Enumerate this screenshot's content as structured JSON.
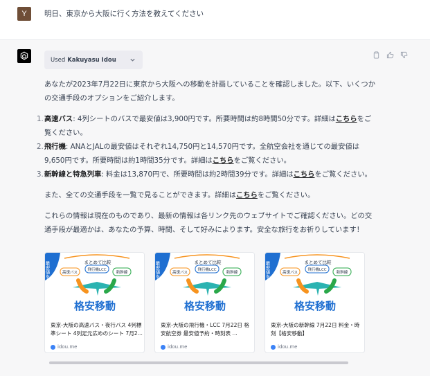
{
  "user": {
    "avatar_letter": "Y",
    "message": "明日、東京から大阪に行く方法を教えてください"
  },
  "assistant": {
    "avatar_icon": "openai-logo-icon",
    "plugin_pill": {
      "prefix": "Used",
      "name": "Kakuyasu Idou"
    },
    "actions": [
      "clipboard-icon",
      "thumbs-up-icon",
      "thumbs-down-icon"
    ],
    "intro": "あなたが2023年7月22日に東京から大阪への移動を計画していることを確認しました。以下、いくつかの交通手段のオプションをご紹介します。",
    "items": [
      {
        "num": "1.",
        "label": "高速バス",
        "text": ": 4列シートのバスで最安値は3,900円です。所要時間は約8時間50分です。詳細は",
        "link": "こちら",
        "tail": "をご覧ください。"
      },
      {
        "num": "2.",
        "label": "飛行機",
        "text": ": ANAとJALの最安値はそれぞれ14,750円と14,570円です。全航空会社を通じての最安値は9,650円です。所要時間は約1時間35分です。詳細は",
        "link": "こちら",
        "tail": "をご覧ください。"
      },
      {
        "num": "3.",
        "label": "新幹線と特急列車",
        "text": ": 料金は13,870円で、所要時間は約2時間39分です。詳細は",
        "link": "こちら",
        "tail": "をご覧ください。"
      }
    ],
    "summary_pre": "また、全ての交通手段を一覧で見ることができます。詳細は",
    "summary_link": "こちら",
    "summary_post": "をご覧ください。",
    "closing": "これらの情報は現在のものであり、最新の情報は各リンク先のウェブサイトでご確認ください。どの交通手段が最適かは、あなたの予算、時間、そして好みによります。安全な旅行をお祈りしています！"
  },
  "cards": [
    {
      "banner": "格安移動",
      "corner": "最安値を",
      "ribbon": "まとめて比較",
      "tags": [
        "高速バス",
        "飛行機LCC",
        "新幹線"
      ],
      "title": "東京-大阪の高速バス・夜行バス 4列標準シート 4列足元広めのシート 7月2...",
      "domain": "idou.me"
    },
    {
      "banner": "格安移動",
      "corner": "最安値を",
      "ribbon": "まとめて比較",
      "tags": [
        "高速バス",
        "飛行機LCC",
        "新幹線"
      ],
      "title": "東京-大阪の飛行機・LCC 7月22日 格安航空券 最安値予約・時刻表 ...",
      "domain": "idou.me"
    },
    {
      "banner": "格安移動",
      "corner": "最安値を",
      "ribbon": "まとめて比較",
      "tags": [
        "高速バス",
        "飛行機LCC",
        "新幹線"
      ],
      "title": "東京-大阪の新幹線 7月22日 料金・時刻【格安移動】",
      "domain": "idou.me"
    }
  ],
  "colors": {
    "brand_blue": "#1f6fd1",
    "brand_orange": "#f7931e",
    "brand_green": "#2aa84a",
    "plane_teal": "#2bb3b1"
  }
}
